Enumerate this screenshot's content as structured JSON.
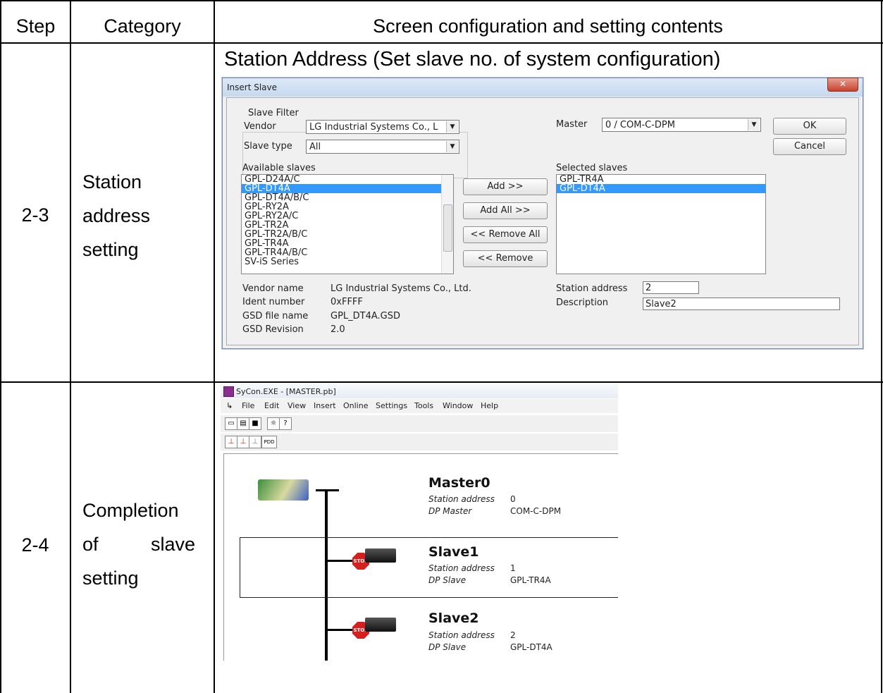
{
  "table": {
    "headers": [
      "Step",
      "Category",
      "Screen configuration and setting contents"
    ],
    "rows": [
      {
        "step": "2-3",
        "category": [
          "Station",
          "address",
          "setting"
        ],
        "caption": "Station Address (Set slave no. of system configuration)"
      },
      {
        "step": "2-4",
        "category": [
          "Completion",
          "of",
          "slave",
          "setting"
        ]
      }
    ]
  },
  "insert_slave": {
    "title": "Insert Slave",
    "close": "✕",
    "slave_filter": "Slave Filter",
    "vendor_label": "Vendor",
    "vendor_value": "LG Industrial Systems Co., L",
    "slave_type_label": "Slave type",
    "slave_type_value": "All",
    "master_label": "Master",
    "master_value": "0 / COM-C-DPM",
    "ok": "OK",
    "cancel": "Cancel",
    "available_label": "Available slaves",
    "available": [
      "GPL-D24A/C",
      "GPL-DT4A",
      "GPL-DT4A/B/C",
      "GPL-RY2A",
      "GPL-RY2A/C",
      "GPL-TR2A",
      "GPL-TR2A/B/C",
      "GPL-TR4A",
      "GPL-TR4A/B/C",
      "SV-iS Series"
    ],
    "selected_label": "Selected slaves",
    "selected": [
      "GPL-TR4A",
      "GPL-DT4A"
    ],
    "add": "Add >>",
    "add_all": "Add All >>",
    "remove_all": "<< Remove All",
    "remove": "<< Remove",
    "vendor_name_label": "Vendor name",
    "vendor_name": "LG Industrial Systems Co., Ltd.",
    "ident_label": "Ident number",
    "ident": "0xFFFF",
    "gsd_file_label": "GSD file name",
    "gsd_file": "GPL_DT4A.GSD",
    "gsd_rev_label": "GSD Revision",
    "gsd_rev": "2.0",
    "station_address_label": "Station address",
    "station_address": "2",
    "description_label": "Description",
    "description": "Slave2"
  },
  "sycon": {
    "title": "SyCon.EXE - [MASTER.pb]",
    "menu": [
      "File",
      "Edit",
      "View",
      "Insert",
      "Online",
      "Settings",
      "Tools",
      "Window",
      "Help"
    ],
    "pdd": "PDD",
    "stop_label": "STOP",
    "nodes": [
      {
        "name": "Master0",
        "p1": "Station address",
        "v1": "0",
        "p2": "DP Master",
        "v2": "COM-C-DPM"
      },
      {
        "name": "Slave1",
        "p1": "Station address",
        "v1": "1",
        "p2": "DP Slave",
        "v2": "GPL-TR4A"
      },
      {
        "name": "Slave2",
        "p1": "Station address",
        "v1": "2",
        "p2": "DP Slave",
        "v2": "GPL-DT4A"
      }
    ]
  }
}
